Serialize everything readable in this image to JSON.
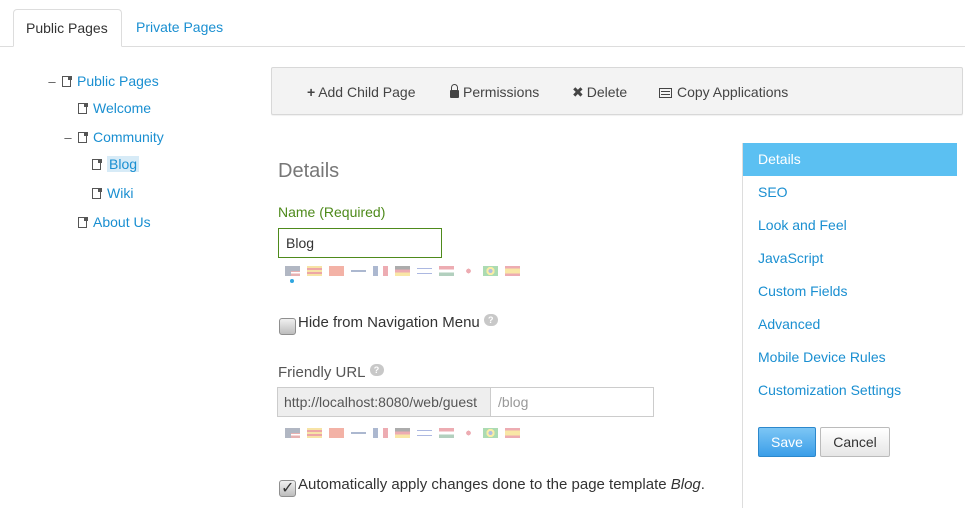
{
  "tabs": [
    {
      "label": "Public Pages",
      "active": true
    },
    {
      "label": "Private Pages",
      "active": false
    }
  ],
  "tree": {
    "nodes": [
      {
        "label": "Public Pages",
        "toggle": "–",
        "selected": false
      },
      {
        "label": "Welcome",
        "toggle": "",
        "selected": false
      },
      {
        "label": "Community",
        "toggle": "–",
        "selected": false
      },
      {
        "label": "Blog",
        "toggle": "",
        "selected": true
      },
      {
        "label": "Wiki",
        "toggle": "",
        "selected": false
      },
      {
        "label": "About Us",
        "toggle": "",
        "selected": false
      }
    ]
  },
  "toolbar": {
    "add_child": {
      "icon": "plus-icon",
      "label": "Add Child Page"
    },
    "permissions": {
      "icon": "lock-icon",
      "label": "Permissions"
    },
    "delete": {
      "icon": "times-icon",
      "label": "Delete"
    },
    "copy_apps": {
      "icon": "list-icon",
      "label": "Copy Applications"
    }
  },
  "form": {
    "section_title": "Details",
    "name_label": "Name (Required)",
    "name_value": "Blog",
    "hide_label": "Hide from Navigation Menu",
    "hide_checked": false,
    "friendly_url_label": "Friendly URL",
    "url_prefix": "http://localhost:8080/web/guest",
    "url_value": "/blog",
    "auto_apply_label": "Automatically apply changes done to the page template ",
    "auto_apply_template": "Blog",
    "auto_apply_suffix": ".",
    "auto_apply_checked": true,
    "help_icon": "question-icon"
  },
  "rightnav": {
    "items": [
      {
        "label": "Details",
        "active": true
      },
      {
        "label": "SEO",
        "active": false
      },
      {
        "label": "Look and Feel",
        "active": false
      },
      {
        "label": "JavaScript",
        "active": false
      },
      {
        "label": "Custom Fields",
        "active": false
      },
      {
        "label": "Advanced",
        "active": false
      },
      {
        "label": "Mobile Device Rules",
        "active": false
      },
      {
        "label": "Customization Settings",
        "active": false
      }
    ],
    "save_label": "Save",
    "cancel_label": "Cancel"
  },
  "colors": {
    "link": "#1a8fd1",
    "required_green": "#4e8a1b",
    "nav_active": "#5bc0f2",
    "save_button": "#3b9ee8"
  },
  "language_flags": [
    "us-flag",
    "ca-es-flag",
    "zh-flag",
    "fi-flag",
    "fr-flag",
    "de-flag",
    "he-flag",
    "hu-flag",
    "ja-flag",
    "pt-br-flag",
    "es-flag"
  ]
}
